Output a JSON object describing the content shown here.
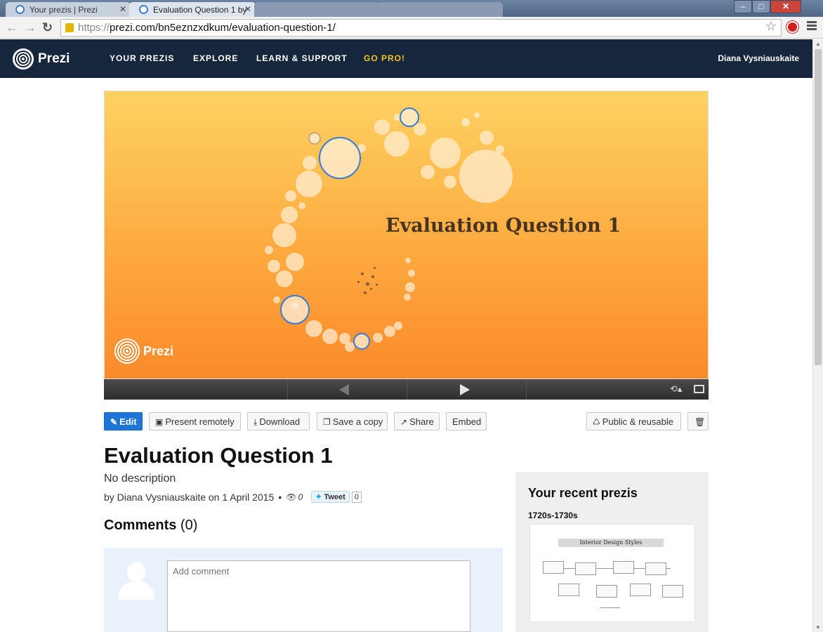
{
  "browser": {
    "tabs": [
      {
        "title": "Your prezis | Prezi"
      },
      {
        "title": "Evaluation Question 1 by"
      },
      {
        "title": ""
      },
      {
        "title": ""
      }
    ],
    "url_scheme": "https://",
    "url_rest": "prezi.com/bn5eznzxdkum/evaluation-question-1/"
  },
  "site_nav": {
    "logo_text": "Prezi",
    "links": [
      "YOUR PREZIS",
      "EXPLORE",
      "LEARN & SUPPORT",
      "GO PRO!"
    ],
    "user": "Diana Vysniauskaite"
  },
  "slide": {
    "title": "Evaluation Question 1",
    "logo_text": "Prezi"
  },
  "actions": {
    "edit": "Edit",
    "present_remotely": "Present remotely",
    "download": "Download",
    "save_copy": "Save a copy",
    "share": "Share",
    "embed": "Embed",
    "public": "Public & reusable"
  },
  "presentation": {
    "title": "Evaluation Question 1",
    "description": "No description",
    "by": "by Diana Vysniauskaite on 1 April 2015",
    "views": "0",
    "tweet_label": "Tweet",
    "tweet_count": "0"
  },
  "comments": {
    "heading": "Comments",
    "count": "(0)",
    "placeholder": "Add comment"
  },
  "recent": {
    "heading": "Your recent prezis",
    "item_name": "1720s-1730s",
    "thumb_banner": "Interior Design Styles"
  }
}
